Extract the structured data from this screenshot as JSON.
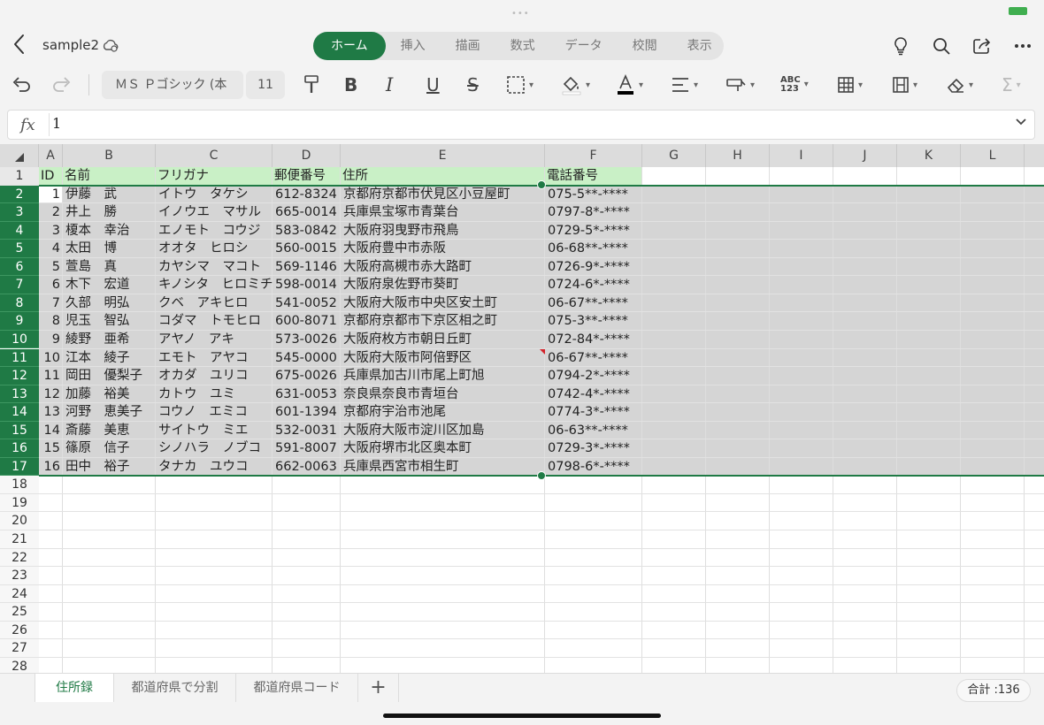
{
  "titlebar": {
    "doc_title": "sample2",
    "grabber": "•••"
  },
  "ribbon_tabs": [
    "ホーム",
    "挿入",
    "描画",
    "数式",
    "データ",
    "校閲",
    "表示"
  ],
  "toolbar": {
    "font_name": "ＭＳ Ｐゴシック (本",
    "font_size": "11",
    "abc_label": "ABC\n123"
  },
  "formula_bar": {
    "fx_label": "fx",
    "value": "1"
  },
  "columns": [
    "A",
    "B",
    "C",
    "D",
    "E",
    "F",
    "G",
    "H",
    "I",
    "J",
    "K",
    "L"
  ],
  "header_row": [
    "ID",
    "名前",
    "フリガナ",
    "郵便番号",
    "住所",
    "電話番号"
  ],
  "rows": [
    [
      "1",
      "伊藤　武",
      "イトウ　タケシ",
      "612-8324",
      "京都府京都市伏見区小豆屋町",
      "075-5**-****"
    ],
    [
      "2",
      "井上　勝",
      "イノウエ　マサル",
      "665-0014",
      "兵庫県宝塚市青葉台",
      "0797-8*-****"
    ],
    [
      "3",
      "榎本　幸治",
      "エノモト　コウジ",
      "583-0842",
      "大阪府羽曳野市飛鳥",
      "0729-5*-****"
    ],
    [
      "4",
      "太田　博",
      "オオタ　ヒロシ",
      "560-0015",
      "大阪府豊中市赤阪",
      "06-68**-****"
    ],
    [
      "5",
      "萱島　真",
      "カヤシマ　マコト",
      "569-1146",
      "大阪府高槻市赤大路町",
      "0726-9*-****"
    ],
    [
      "6",
      "木下　宏道",
      "キノシタ　ヒロミチ",
      "598-0014",
      "大阪府泉佐野市葵町",
      "0724-6*-****"
    ],
    [
      "7",
      "久部　明弘",
      "クベ　アキヒロ",
      "541-0052",
      "大阪府大阪市中央区安土町",
      "06-67**-****"
    ],
    [
      "8",
      "児玉　智弘",
      "コダマ　トモヒロ",
      "600-8071",
      "京都府京都市下京区相之町",
      "075-3**-****"
    ],
    [
      "9",
      "綾野　亜希",
      "アヤノ　アキ",
      "573-0026",
      "大阪府枚方市朝日丘町",
      "072-84*-****"
    ],
    [
      "10",
      "江本　綾子",
      "エモト　アヤコ",
      "545-0000",
      "大阪府大阪市阿倍野区",
      "06-67**-****"
    ],
    [
      "11",
      "岡田　優梨子",
      "オカダ　ユリコ",
      "675-0026",
      "兵庫県加古川市尾上町旭",
      "0794-2*-****"
    ],
    [
      "12",
      "加藤　裕美",
      "カトウ　ユミ",
      "631-0053",
      "奈良県奈良市青垣台",
      "0742-4*-****"
    ],
    [
      "13",
      "河野　恵美子",
      "コウノ　エミコ",
      "601-1394",
      "京都府宇治市池尾",
      "0774-3*-****"
    ],
    [
      "14",
      "斎藤　美恵",
      "サイトウ　ミエ",
      "532-0031",
      "大阪府大阪市淀川区加島",
      "06-63**-****"
    ],
    [
      "15",
      "篠原　信子",
      "シノハラ　ノブコ",
      "591-8007",
      "大阪府堺市北区奥本町",
      "0729-3*-****"
    ],
    [
      "16",
      "田中　裕子",
      "タナカ　ユウコ",
      "662-0063",
      "兵庫県西宮市相生町",
      "0798-6*-****"
    ]
  ],
  "row_numbers": [
    "1",
    "2",
    "3",
    "4",
    "5",
    "6",
    "7",
    "8",
    "9",
    "10",
    "11",
    "12",
    "13",
    "14",
    "15",
    "16",
    "17",
    "18",
    "19",
    "20",
    "21",
    "22",
    "23",
    "24",
    "25",
    "26",
    "27",
    "28"
  ],
  "sheets": [
    "住所録",
    "都道府県で分割",
    "都道府県コード"
  ],
  "add_sheet": "+",
  "status": {
    "sum": "合計 :136"
  },
  "colors": {
    "accent": "#1f7a45",
    "header_fill": "#c9f0c6",
    "selection_fill": "#d5d5d5"
  }
}
